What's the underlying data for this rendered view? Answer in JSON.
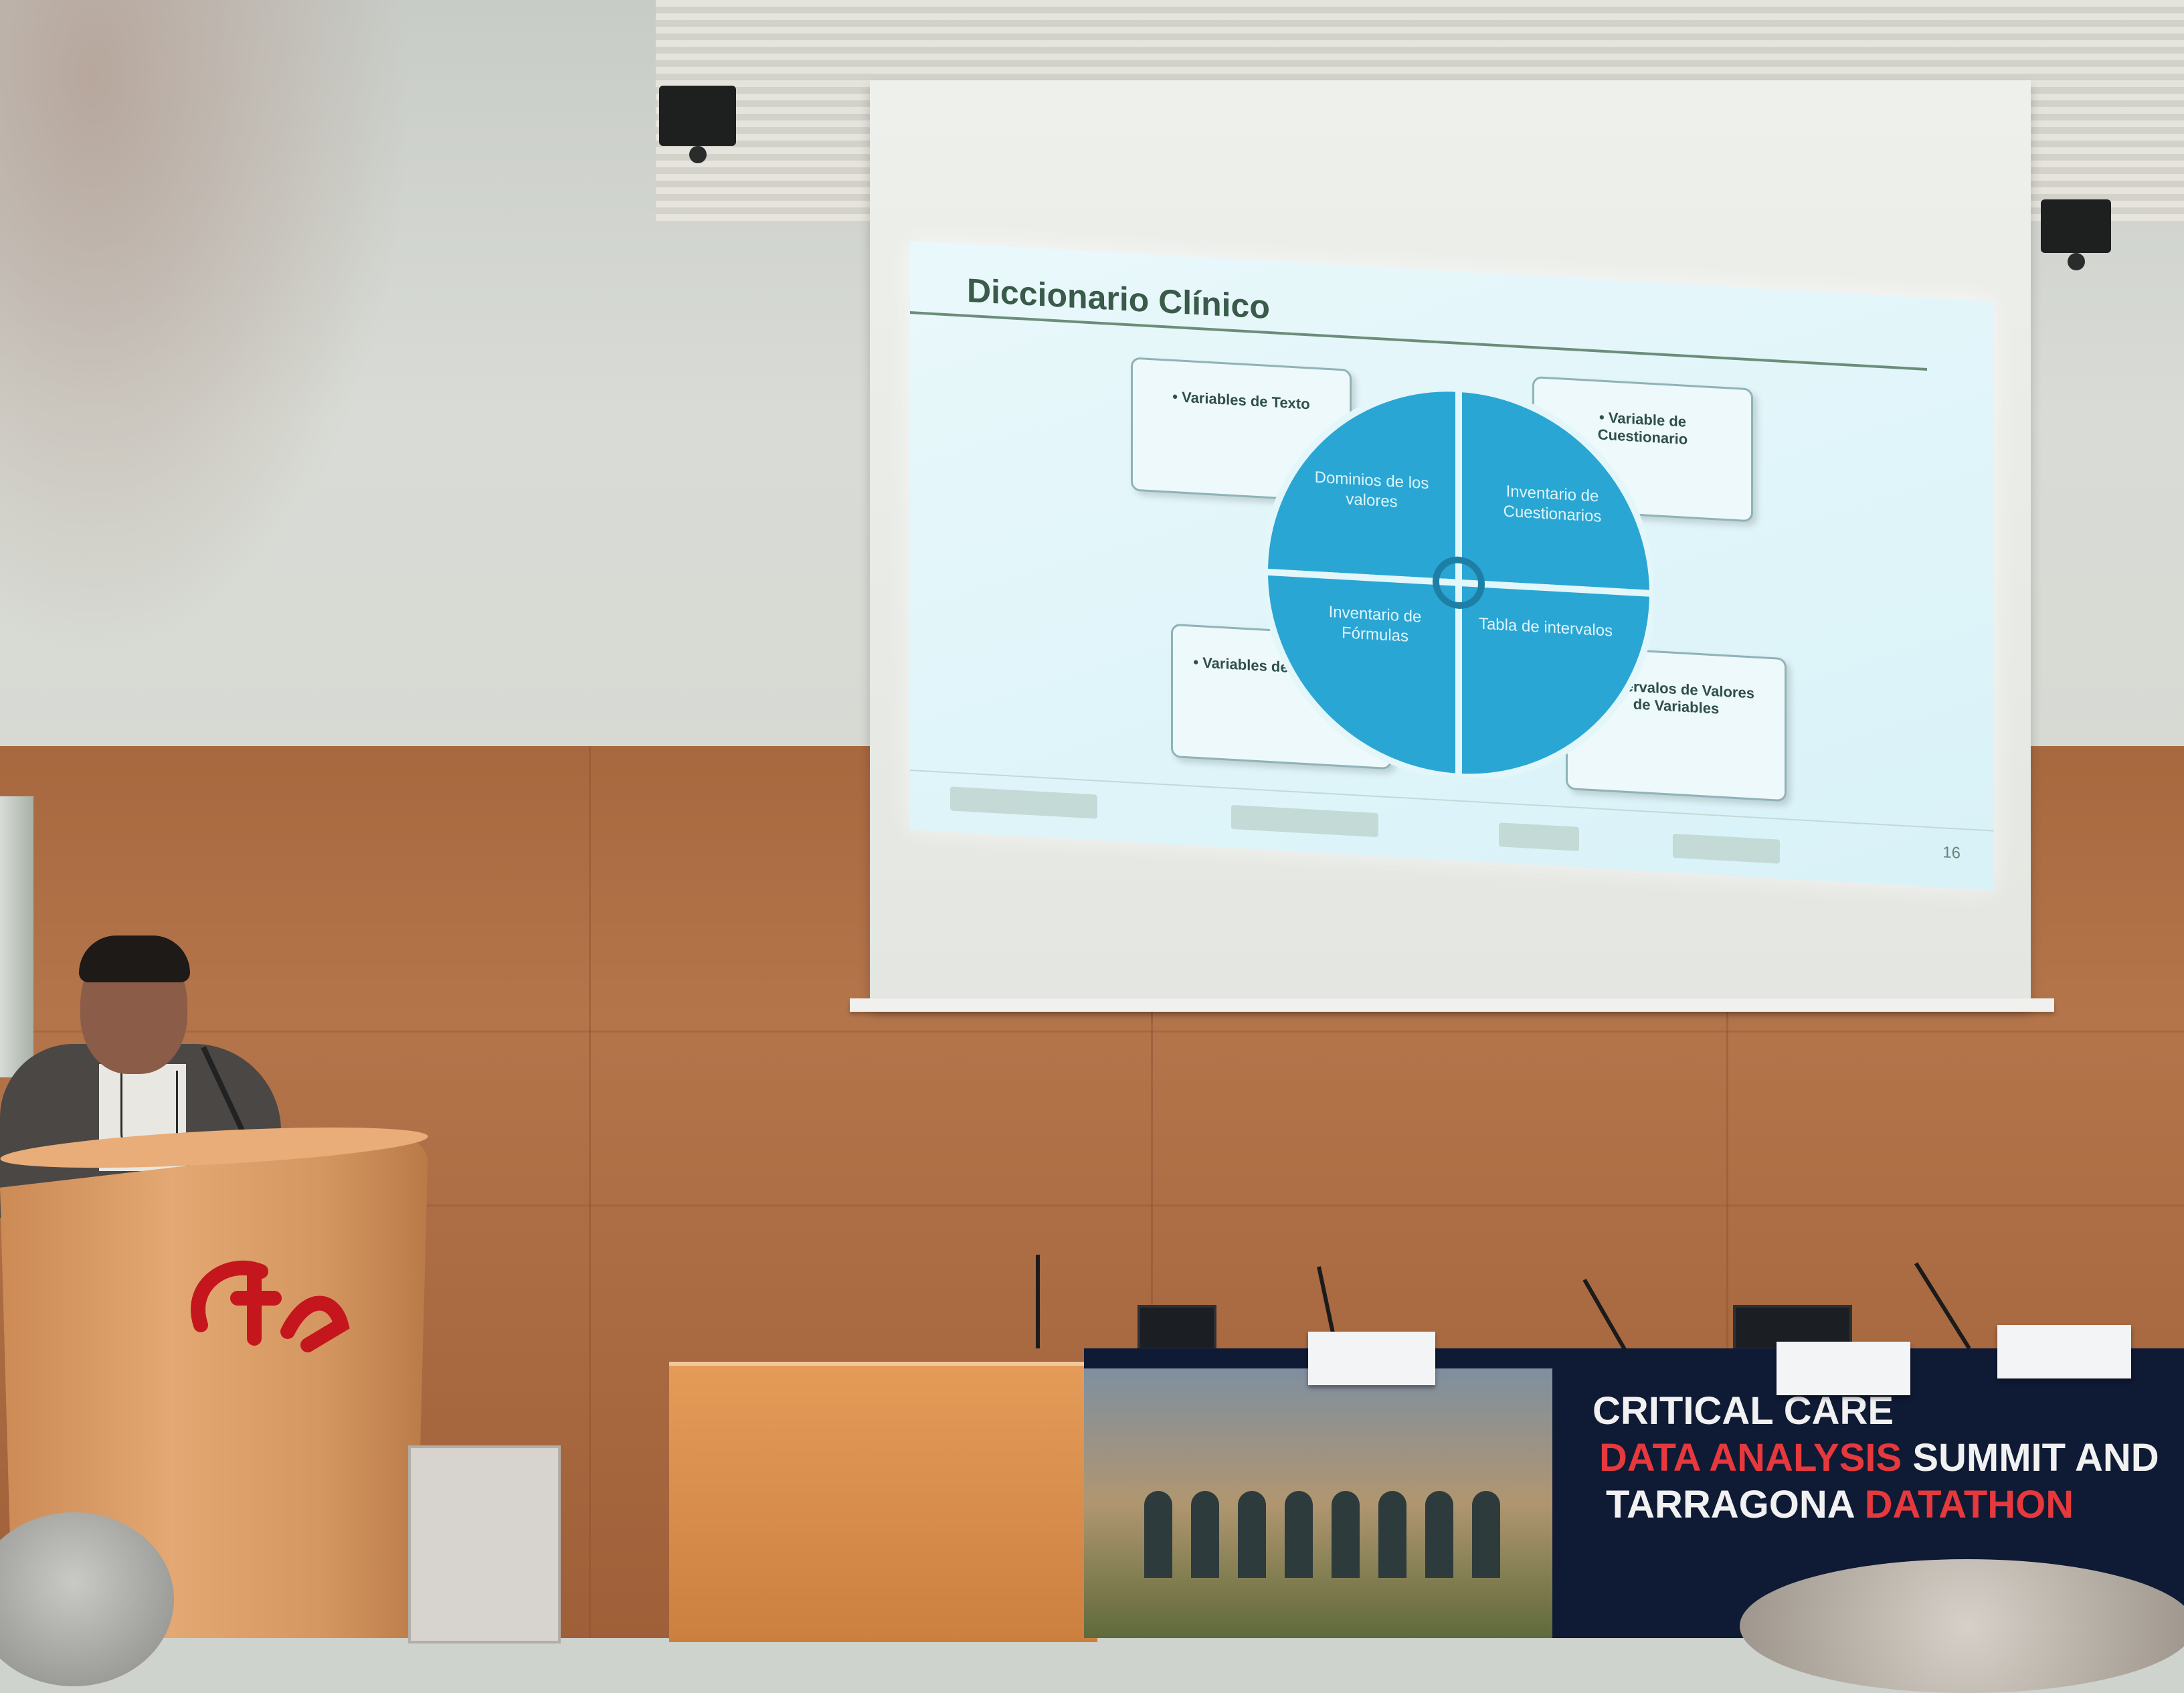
{
  "slide": {
    "title": "Diccionario Clínico",
    "corner_boxes": [
      {
        "id": "top-left",
        "text": "• Variables de Texto"
      },
      {
        "id": "top-right",
        "text": "• Variable de Cuestionario"
      },
      {
        "id": "bottom-left",
        "text": "• Variables de Formulario"
      },
      {
        "id": "bottom-right",
        "text": "• Intervalos de Valores de Variables"
      }
    ],
    "quadrants": [
      {
        "id": "tl",
        "text": "Dominios de los valores"
      },
      {
        "id": "tr",
        "text": "Inventario de Cuestionarios"
      },
      {
        "id": "bl",
        "text": "Inventario de Fórmulas"
      },
      {
        "id": "br",
        "text": "Tabla de intervalos"
      }
    ],
    "page_number": "16",
    "colors": {
      "quadrant_fill": "#2aa6d4",
      "background": "#e3f6fa",
      "title": "#3a5a4a"
    }
  },
  "banner": {
    "line1": "CRITICAL CARE",
    "line2_red": "DATA ANALYSIS",
    "line2_white": " SUMMIT AND",
    "line3_white": "TARRAGONA ",
    "line3_red": "DATATHON",
    "colors": {
      "background": "#0f1a35",
      "accent": "#e5393d"
    }
  },
  "podium": {
    "logo_icon": "university-logo-icon",
    "color": "#c4161c"
  }
}
